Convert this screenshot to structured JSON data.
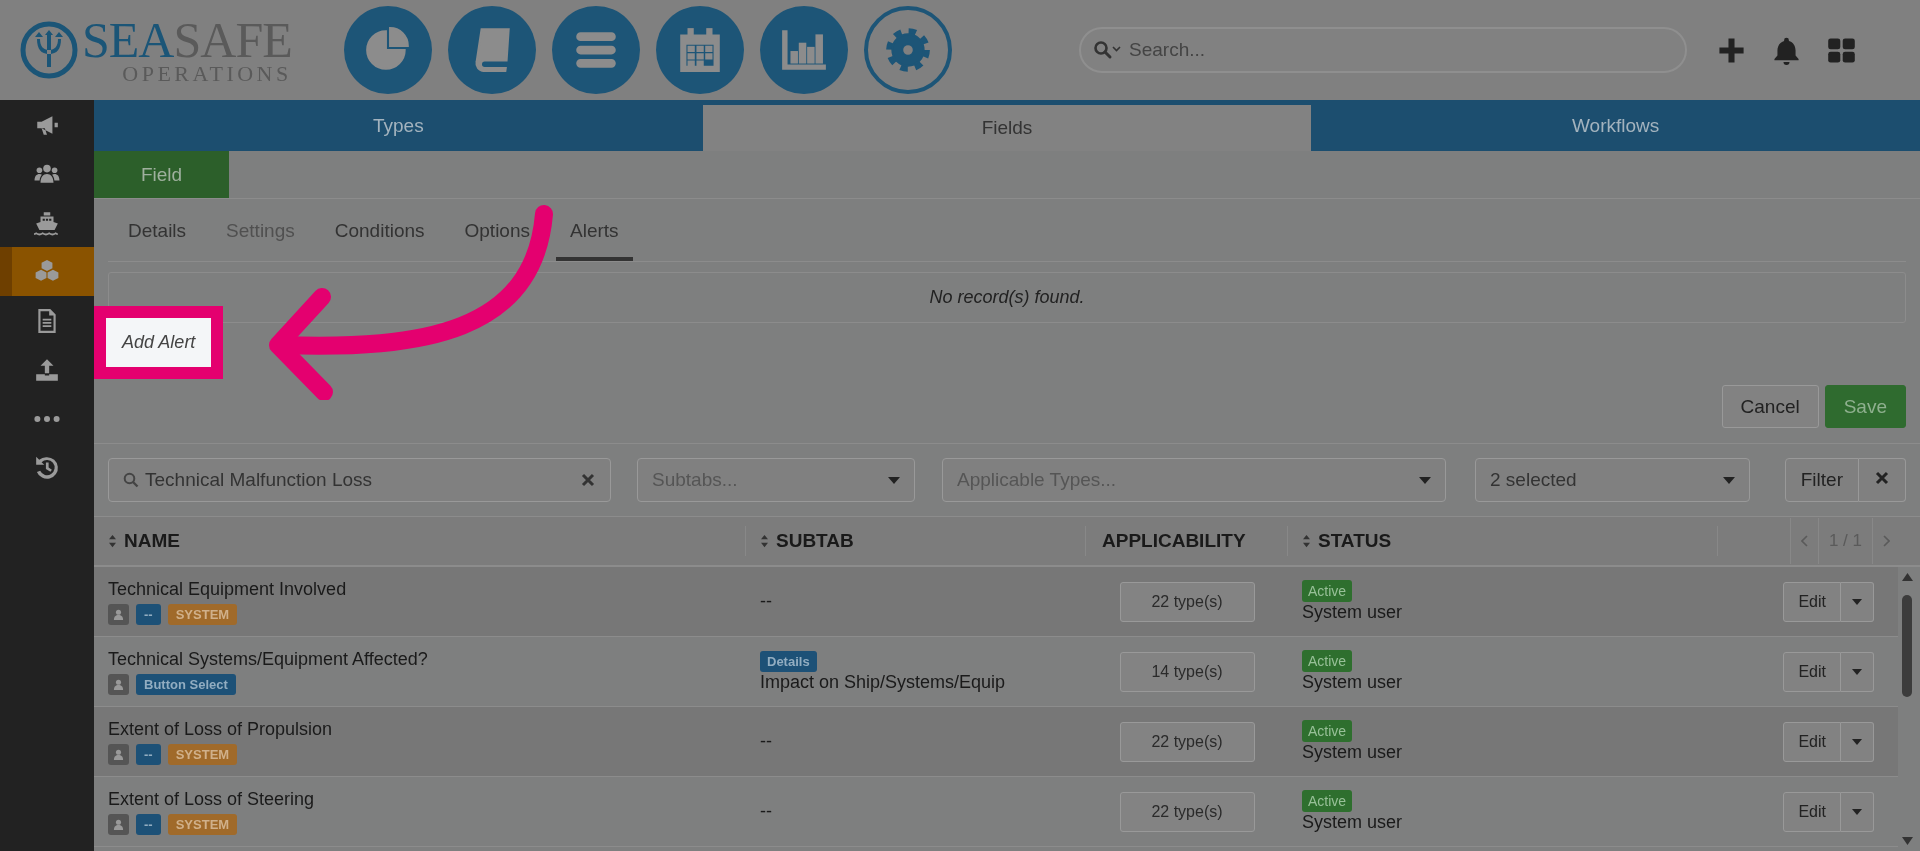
{
  "logo": {
    "word_1": "SEA",
    "word_2": "SAFE",
    "subtitle": "OPERATIONS"
  },
  "nav_buttons": [
    {
      "selected": false
    },
    {
      "selected": false
    },
    {
      "selected": false
    },
    {
      "selected": false
    },
    {
      "selected": false
    },
    {
      "selected": true
    }
  ],
  "search": {
    "placeholder": "Search..."
  },
  "sidebar": {
    "items": [
      {
        "selected": false
      },
      {
        "selected": false
      },
      {
        "selected": false
      },
      {
        "selected": true
      },
      {
        "selected": false
      },
      {
        "selected": false
      },
      {
        "selected": false
      },
      {
        "selected": false
      }
    ]
  },
  "tabs": [
    {
      "label": "Types",
      "selected": false
    },
    {
      "label": "Fields",
      "selected": true
    },
    {
      "label": "Workflows",
      "selected": false
    }
  ],
  "section_tab": {
    "label": "Field"
  },
  "subtabs": [
    {
      "label": "Details",
      "selected": false,
      "disabled": false
    },
    {
      "label": "Settings",
      "selected": false,
      "disabled": true
    },
    {
      "label": "Conditions",
      "selected": false,
      "disabled": false
    },
    {
      "label": "Options",
      "selected": false,
      "disabled": false
    },
    {
      "label": "Alerts",
      "selected": true,
      "disabled": false
    }
  ],
  "alerts": {
    "empty_message": "No record(s) found.",
    "add_button": "Add Alert",
    "highlighted": true
  },
  "form_buttons": [
    {
      "label": "Cancel",
      "kind": "default"
    },
    {
      "label": "Save",
      "kind": "primary"
    }
  ],
  "filters": {
    "search": {
      "value": "Technical Malfunction Loss"
    },
    "dropdowns": [
      {
        "placeholder": "Subtabs..."
      },
      {
        "placeholder": "Applicable Types..."
      },
      {
        "value": "2 selected"
      }
    ],
    "filter_button": "Filter"
  },
  "table": {
    "columns": [
      {
        "label": "NAME",
        "sortable": true
      },
      {
        "label": "SUBTAB",
        "sortable": true
      },
      {
        "label": "APPLICABILITY",
        "sortable": false
      },
      {
        "label": "STATUS",
        "sortable": true
      }
    ],
    "pagination": "1 / 1",
    "rows": [
      {
        "name": "Technical Equipment Involved",
        "tags": [
          {
            "kind": "user"
          },
          {
            "kind": "type",
            "label": "--"
          },
          {
            "kind": "system",
            "label": "SYSTEM"
          }
        ],
        "subtab": {
          "text": "--"
        },
        "applicability": "22 type(s)",
        "status": "Active",
        "owner": "System user",
        "action": "Edit"
      },
      {
        "name": "Technical Systems/Equipment Affected?",
        "tags": [
          {
            "kind": "user"
          },
          {
            "kind": "type",
            "label": "Button Select"
          }
        ],
        "subtab": {
          "tag": "Details",
          "text": "Impact on Ship/Systems/Equip"
        },
        "applicability": "14 type(s)",
        "status": "Active",
        "owner": "System user",
        "action": "Edit"
      },
      {
        "name": "Extent of Loss of Propulsion",
        "tags": [
          {
            "kind": "user"
          },
          {
            "kind": "type",
            "label": "--"
          },
          {
            "kind": "system",
            "label": "SYSTEM"
          }
        ],
        "subtab": {
          "text": "--"
        },
        "applicability": "22 type(s)",
        "status": "Active",
        "owner": "System user",
        "action": "Edit"
      },
      {
        "name": "Extent of Loss of Steering",
        "tags": [
          {
            "kind": "user"
          },
          {
            "kind": "type",
            "label": "--"
          },
          {
            "kind": "system",
            "label": "SYSTEM"
          }
        ],
        "subtab": {
          "text": "--"
        },
        "applicability": "22 type(s)",
        "status": "Active",
        "owner": "System user",
        "action": "Edit"
      }
    ]
  }
}
